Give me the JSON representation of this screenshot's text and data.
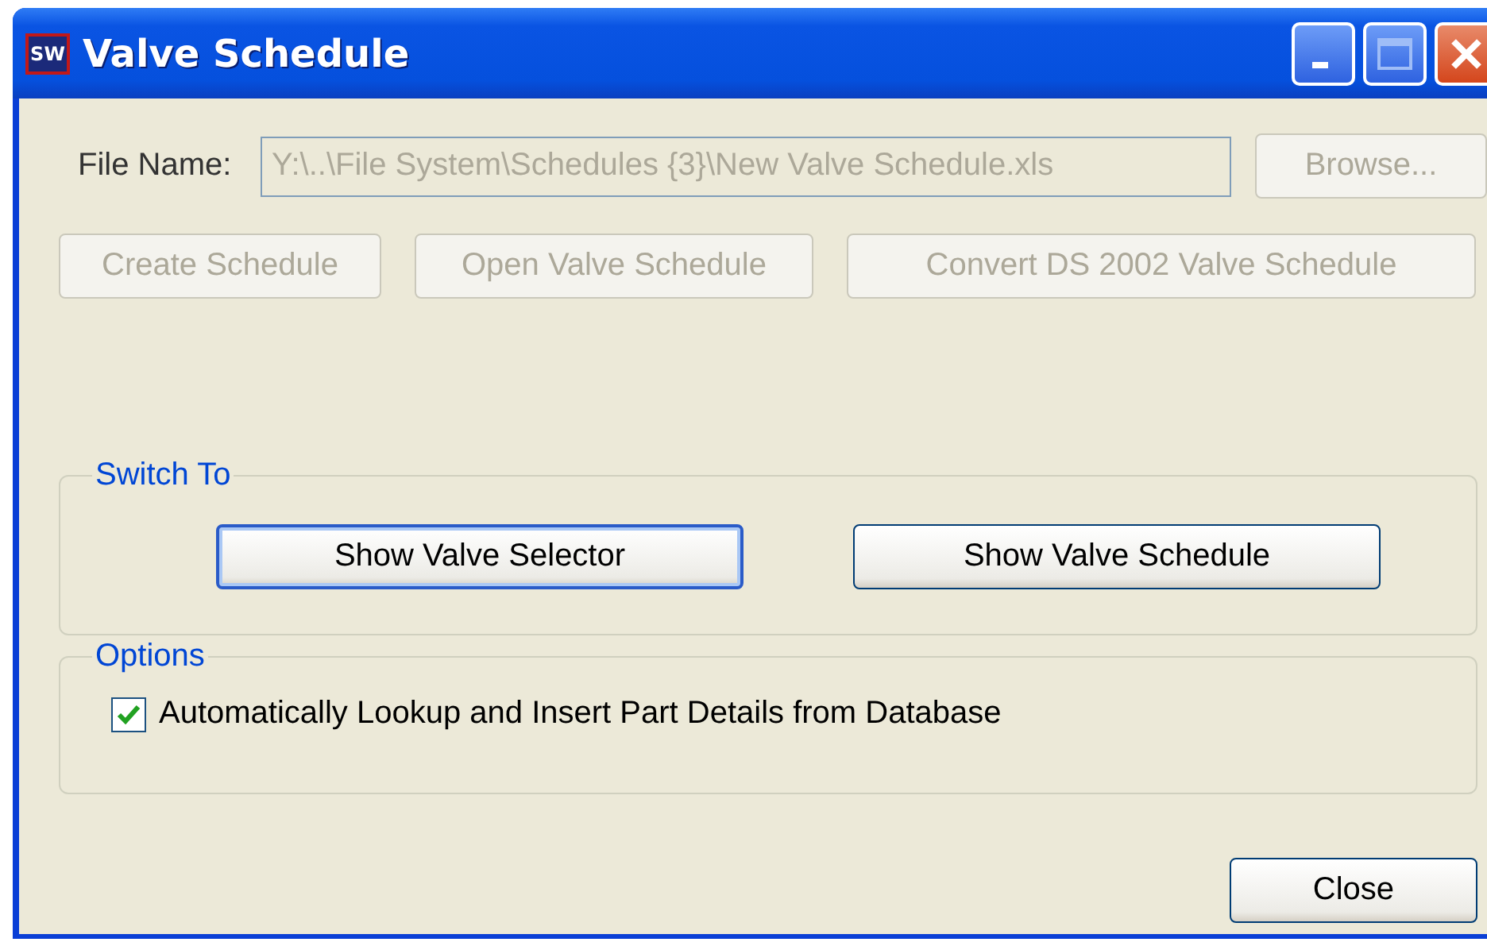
{
  "window": {
    "title": "Valve Schedule",
    "app_icon": "SW"
  },
  "file": {
    "label": "File Name:",
    "value": "Y:\\..\\File System\\Schedules {3}\\New Valve Schedule.xls",
    "disabled": true
  },
  "browse_button": {
    "label": "Browse...",
    "disabled": true
  },
  "action_buttons": [
    {
      "label": "Create Schedule",
      "disabled": true
    },
    {
      "label": "Open Valve Schedule",
      "disabled": true
    },
    {
      "label": "Convert DS 2002 Valve Schedule",
      "disabled": true
    }
  ],
  "switch_to": {
    "title": "Switch To",
    "buttons": [
      {
        "label": "Show Valve Selector",
        "focused": true
      },
      {
        "label": "Show Valve Schedule",
        "focused": false
      }
    ]
  },
  "options": {
    "title": "Options",
    "items": [
      {
        "label": "Automatically Lookup and Insert Part Details from Database",
        "checked": true
      }
    ]
  },
  "close_button": {
    "label": "Close"
  }
}
